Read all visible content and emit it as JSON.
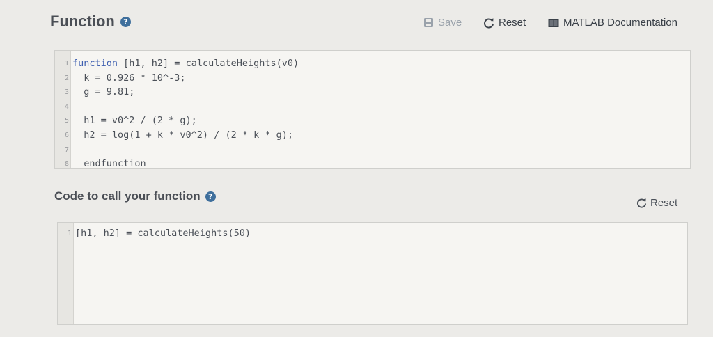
{
  "function_section": {
    "title": "Function",
    "help_glyph": "?",
    "toolbar": {
      "save_label": "Save",
      "reset_label": "Reset",
      "doc_label": "MATLAB Documentation"
    },
    "code_lines": [
      {
        "num": "1",
        "keyword": "function",
        "rest": " [h1, h2] = calculateHeights(v0)"
      },
      {
        "num": "2",
        "keyword": "",
        "rest": "  k = 0.926 * 10^-3;"
      },
      {
        "num": "3",
        "keyword": "",
        "rest": "  g = 9.81;"
      },
      {
        "num": "4",
        "keyword": "",
        "rest": ""
      },
      {
        "num": "5",
        "keyword": "",
        "rest": "  h1 = v0^2 / (2 * g);"
      },
      {
        "num": "6",
        "keyword": "",
        "rest": "  h2 = log(1 + k * v0^2) / (2 * k * g);"
      },
      {
        "num": "7",
        "keyword": "",
        "rest": ""
      },
      {
        "num": "8",
        "keyword": "",
        "rest": "  endfunction"
      }
    ]
  },
  "call_section": {
    "title": "Code to call your function",
    "help_glyph": "?",
    "reset_label": "Reset",
    "code_lines": [
      {
        "num": "1",
        "keyword": "",
        "rest": "[h1, h2] = calculateHeights(50)"
      }
    ]
  },
  "colors": {
    "keyword": "#3e5fb0",
    "help_icon": "#3f6f9c",
    "disabled": "#9aa2ab"
  },
  "icons": {
    "save": "floppy-disk-icon",
    "reset": "refresh-icon",
    "documentation": "book-icon",
    "help": "question-circle-icon"
  }
}
